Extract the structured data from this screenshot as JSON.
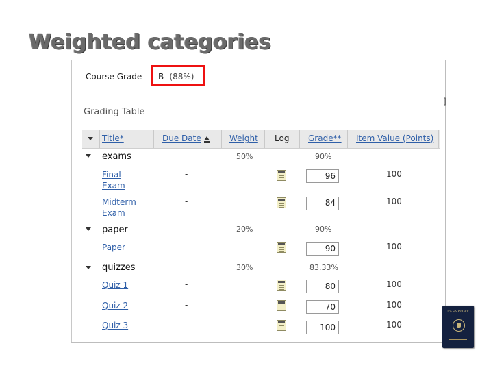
{
  "slide": {
    "title": "Weighted categories"
  },
  "course": {
    "grade_label": "Course Grade",
    "grade_letter": "B-",
    "grade_pct": "(88%)"
  },
  "grading_table": {
    "title": "Grading Table",
    "headers": {
      "title": "Title*",
      "due_date": "Due Date",
      "weight": "Weight",
      "log": "Log",
      "grade": "Grade**",
      "item_value": "Item Value (Points)"
    },
    "categories": [
      {
        "name": "exams",
        "weight": "50%",
        "grade": "90%",
        "items": [
          {
            "title_line1": "Final",
            "title_line2": "Exam",
            "due": "-",
            "score": "96",
            "points": "100"
          },
          {
            "title_line1": "Midterm",
            "title_line2": "Exam",
            "due": "-",
            "score": "84",
            "points": "100"
          }
        ]
      },
      {
        "name": "paper",
        "weight": "20%",
        "grade": "90%",
        "items": [
          {
            "title_line1": "Paper",
            "due": "-",
            "score": "90",
            "points": "100"
          }
        ]
      },
      {
        "name": "quizzes",
        "weight": "30%",
        "grade": "83.33%",
        "items": [
          {
            "title_line1": "Quiz 1",
            "due": "-",
            "score": "80",
            "points": "100"
          },
          {
            "title_line1": "Quiz 2",
            "due": "-",
            "score": "70",
            "points": "100"
          },
          {
            "title_line1": "Quiz 3",
            "due": "-",
            "score": "100",
            "points": "100"
          }
        ]
      }
    ]
  },
  "icons": {
    "log": "log-icon",
    "collapse": "collapse-triangle-icon",
    "sort": "sort-ascending-icon"
  },
  "colors": {
    "highlight_border": "#e11111",
    "link": "#2f5fa8",
    "header_bg": "#e9e9e9"
  },
  "edge_mark": "]"
}
